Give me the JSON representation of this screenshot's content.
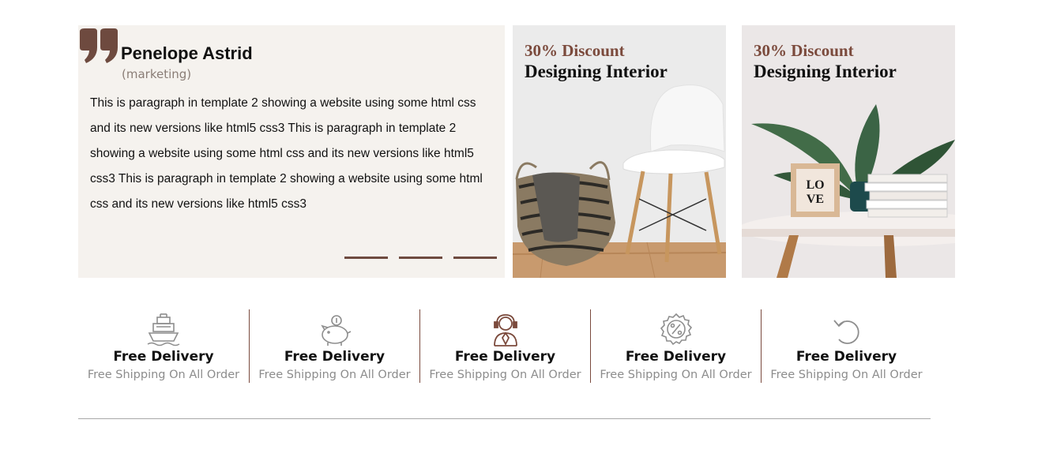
{
  "testimonial": {
    "name": "Penelope Astrid",
    "role": "(marketing)",
    "text": "This is paragraph in template 2 showing a website using some html css and its new versions like html5 css3 This is paragraph in template 2 showing a website using some html css and its new versions like html5 css3 This is paragraph in template 2 showing a website using some html css and its new versions like html5 css3",
    "slides": 3
  },
  "promos": [
    {
      "discount": "30% Discount",
      "title": "Designing Interior",
      "image": "chair-and-basket"
    },
    {
      "discount": "30% Discount",
      "title": "Designing Interior",
      "image": "table-with-plant"
    }
  ],
  "features": [
    {
      "icon": "ship-icon",
      "title": "Free Delivery",
      "subtitle": "Free Shipping On All Order"
    },
    {
      "icon": "piggy-bank-icon",
      "title": "Free Delivery",
      "subtitle": "Free Shipping On All Order"
    },
    {
      "icon": "support-agent-icon",
      "title": "Free Delivery",
      "subtitle": "Free Shipping On All Order"
    },
    {
      "icon": "discount-badge-icon",
      "title": "Free Delivery",
      "subtitle": "Free Shipping On All Order"
    },
    {
      "icon": "return-arrow-icon",
      "title": "Free Delivery",
      "subtitle": "Free Shipping On All Order"
    }
  ],
  "colors": {
    "accent": "#7b4a3c",
    "testimonial_bg": "#f5f2ee",
    "divider": "#a8a8a8"
  }
}
